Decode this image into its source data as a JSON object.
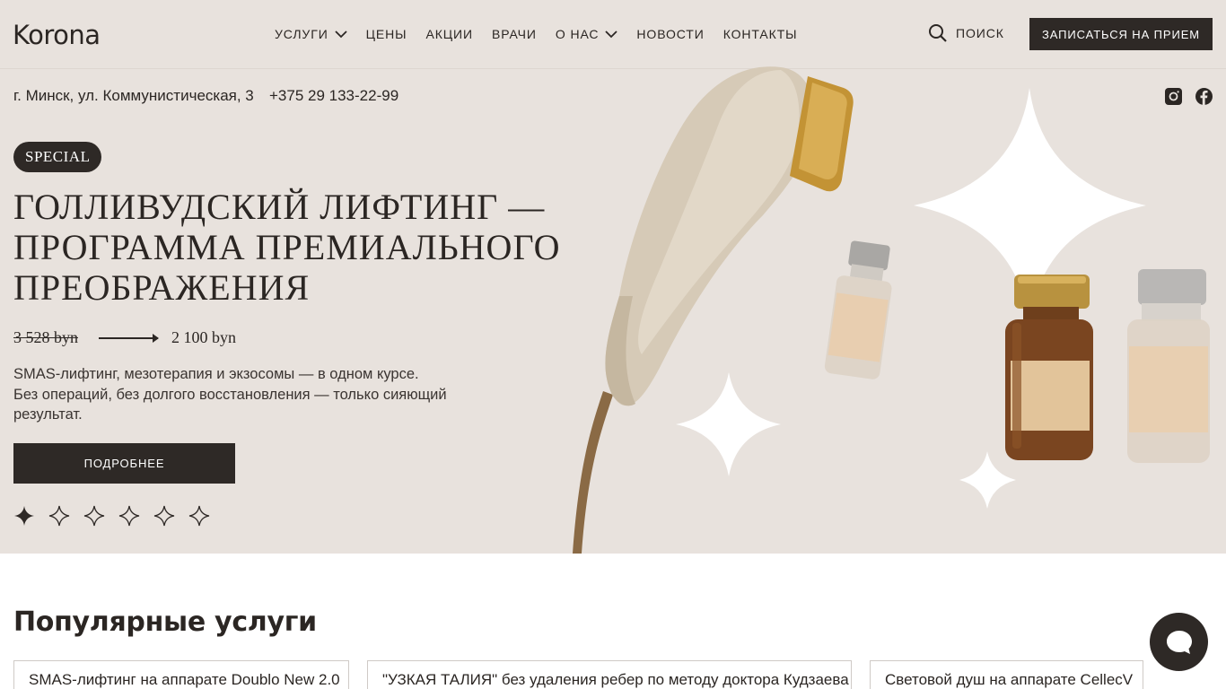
{
  "header": {
    "logo": "Korona",
    "nav": [
      {
        "label": "УСЛУГИ",
        "has_dropdown": true
      },
      {
        "label": "ЦЕНЫ",
        "has_dropdown": false
      },
      {
        "label": "АКЦИИ",
        "has_dropdown": false
      },
      {
        "label": "ВРАЧИ",
        "has_dropdown": false
      },
      {
        "label": "О НАС",
        "has_dropdown": true
      },
      {
        "label": "НОВОСТИ",
        "has_dropdown": false
      },
      {
        "label": "КОНТАКТЫ",
        "has_dropdown": false
      }
    ],
    "search_label": "ПОИСК",
    "cta_label": "ЗАПИСАТЬСЯ НА ПРИЕМ"
  },
  "contact": {
    "address": "г. Минск, ул. Коммунистическая, 3",
    "phone": "+375 29 133-22-99",
    "social": [
      "instagram-icon",
      "facebook-icon"
    ]
  },
  "hero": {
    "badge": "SPECIAL",
    "title_lines": [
      "ГОЛЛИВУДСКИЙ ЛИФТИНГ —",
      "ПРОГРАММА ПРЕМИАЛЬНОГО",
      "ПРЕОБРАЖЕНИЯ"
    ],
    "price_old": "3 528 byn",
    "price_new": "2 100 byn",
    "description_lines": [
      "SMAS-лифтинг, мезотерапия и экзосомы — в одном курсе.",
      "Без операций, без долгого восстановления — только сияющий",
      "результат."
    ],
    "button_label": "ПОДРОБНЕЕ",
    "slides_total": 6,
    "slide_active": 1
  },
  "popular": {
    "title": "Популярные услуги",
    "items": [
      "SMAS-лифтинг на аппарате Doublo New 2.0",
      "\"УЗКАЯ ТАЛИЯ\" без удаления ребер по методу доктора Кудзаева",
      "Световой душ на аппарате CellecV"
    ]
  },
  "colors": {
    "hero_bg": "#e8e2dd",
    "dark": "#2e2926",
    "accent_gold": "#c9983a"
  }
}
